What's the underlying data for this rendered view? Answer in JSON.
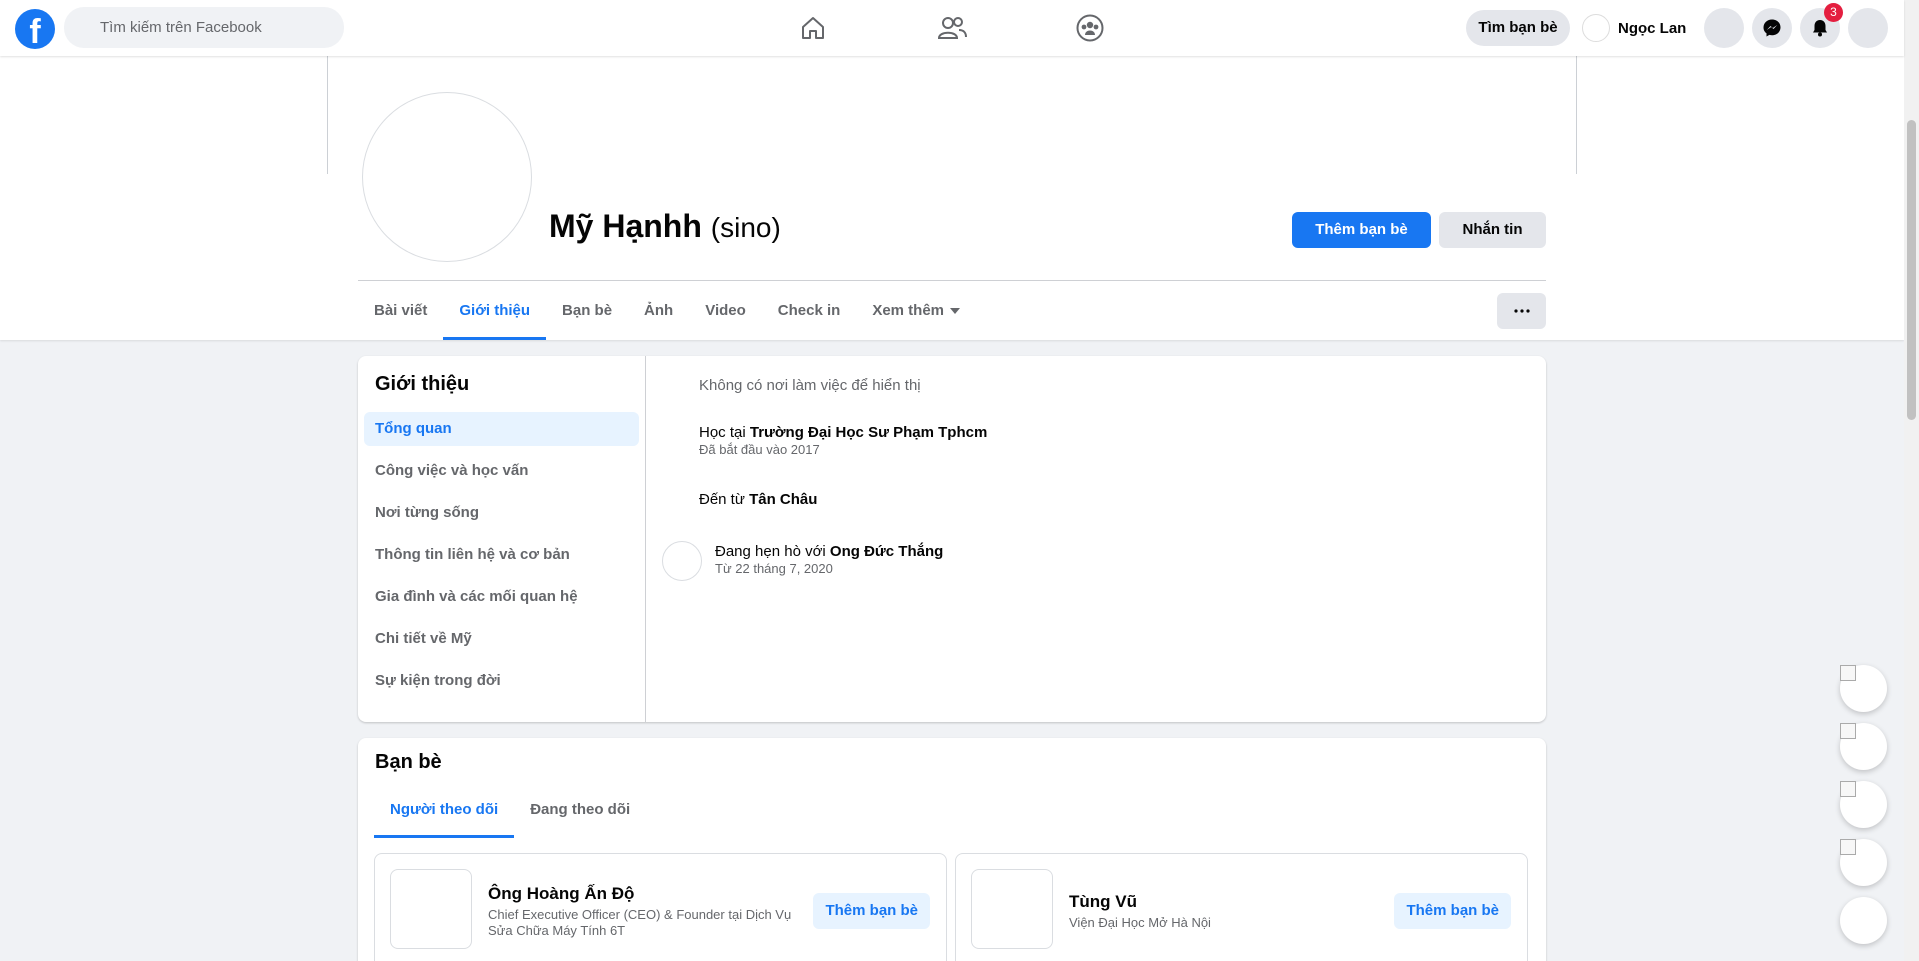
{
  "topbar": {
    "search_placeholder": "Tìm kiếm trên Facebook",
    "find_friends": "Tìm bạn bè",
    "user_name": "Ngọc Lan",
    "notifications_count": "3",
    "nav_icons": [
      "home-icon",
      "friends-icon",
      "groups-icon"
    ]
  },
  "profile": {
    "name": "Mỹ Hạnhh",
    "alternate_name": "(sino)",
    "add_friend_label": "Thêm bạn bè",
    "message_label": "Nhắn tin",
    "tabs": [
      "Bài viết",
      "Giới thiệu",
      "Bạn bè",
      "Ảnh",
      "Video",
      "Check in",
      "Xem thêm"
    ],
    "active_tab": "Giới thiệu"
  },
  "about": {
    "title": "Giới thiệu",
    "menu": [
      "Tổng quan",
      "Công việc và học vấn",
      "Nơi từng sống",
      "Thông tin liên hệ và cơ bản",
      "Gia đình và các mối quan hệ",
      "Chi tiết về Mỹ",
      "Sự kiện trong đời"
    ],
    "work": "Không có nơi làm việc để hiển thị",
    "education_prefix": "Học tại",
    "education_school": "Trường Đại Học Sư Phạm Tphcm",
    "education_sub": "Đã bắt đầu vào 2017",
    "hometown_prefix": "Đến từ",
    "hometown": "Tân Châu",
    "relationship_prefix": "Đang hẹn hò với",
    "relationship_partner": "Ong Đức Thắng",
    "relationship_sub": "Từ 22 tháng 7, 2020"
  },
  "friends": {
    "title": "Bạn bè",
    "tabs": [
      "Người theo dõi",
      "Đang theo dõi"
    ],
    "cards": [
      {
        "name": "Ông Hoàng Ấn Độ",
        "subtitle": "Chief Executive Officer (CEO) & Founder tại Dịch Vụ Sửa Chữa Máy Tính 6T",
        "button": "Thêm bạn bè"
      },
      {
        "name": "Tùng Vũ",
        "subtitle": "Viện Đại Học Mở Hà Nội",
        "button": "Thêm bạn bè"
      }
    ]
  },
  "colors": {
    "accent": "#1877f2",
    "badge": "#e41e3f",
    "background": "#f0f2f5"
  }
}
